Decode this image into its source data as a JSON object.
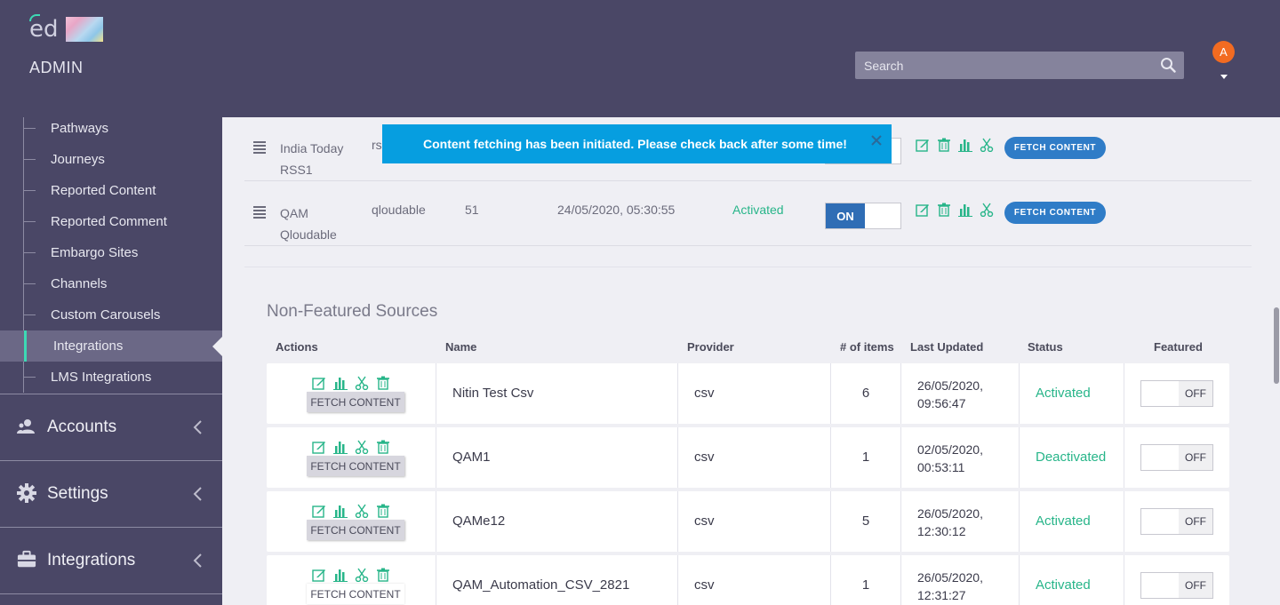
{
  "header": {
    "logo_text": "ed",
    "title": "ADMIN",
    "search_placeholder": "Search",
    "avatar_initial": "A"
  },
  "sidebar": {
    "subitems": [
      {
        "label": "Pathways"
      },
      {
        "label": "Journeys"
      },
      {
        "label": "Reported Content"
      },
      {
        "label": "Reported Comment"
      },
      {
        "label": "Embargo Sites"
      },
      {
        "label": "Channels"
      },
      {
        "label": "Custom Carousels"
      },
      {
        "label": "Integrations",
        "active": true
      },
      {
        "label": "LMS Integrations"
      }
    ],
    "sections": [
      {
        "label": "Accounts",
        "icon": "users-icon"
      },
      {
        "label": "Settings",
        "icon": "gear-icon"
      },
      {
        "label": "Integrations",
        "icon": "briefcase-icon"
      }
    ]
  },
  "toast": {
    "message": "Content fetching has been initiated. Please check back after some time!"
  },
  "featured_rows": [
    {
      "name": "India Today RSS1",
      "provider": "rs",
      "items": "",
      "last_updated": "",
      "status": "",
      "toggle": "",
      "fetch_label": "FETCH CONTENT"
    },
    {
      "name": "QAM Qloudable",
      "provider": "qloudable",
      "items": "51",
      "last_updated": "24/05/2020, 05:30:55",
      "status": "Activated",
      "toggle": "ON",
      "fetch_label": "FETCH CONTENT"
    }
  ],
  "non_featured": {
    "title": "Non-Featured Sources",
    "columns": [
      "Actions",
      "Name",
      "Provider",
      "# of items",
      "Last Updated",
      "Status",
      "Featured"
    ],
    "rows": [
      {
        "name": "Nitin Test Csv",
        "provider": "csv",
        "items": "6",
        "date": "26/05/2020,",
        "time": "09:56:47",
        "status": "Activated",
        "featured": "OFF",
        "fetch_label": "FETCH CONTENT"
      },
      {
        "name": "QAM1",
        "provider": "csv",
        "items": "1",
        "date": "02/05/2020,",
        "time": "00:53:11",
        "status": "Deactivated",
        "featured": "OFF",
        "fetch_label": "FETCH CONTENT"
      },
      {
        "name": "QAMe12",
        "provider": "csv",
        "items": "5",
        "date": "26/05/2020,",
        "time": "12:30:12",
        "status": "Activated",
        "featured": "OFF",
        "fetch_label": "FETCH CONTENT"
      },
      {
        "name": "QAM_Automation_CSV_2821",
        "provider": "csv",
        "items": "1",
        "date": "26/05/2020,",
        "time": "12:31:27",
        "status": "Activated",
        "featured": "OFF",
        "fetch_label": "FETCH CONTENT"
      }
    ]
  },
  "colors": {
    "nav_bg": "#4a4766",
    "accent_green": "#27b589",
    "toggle_blue": "#2f6db5",
    "toast_blue": "#069ee0"
  }
}
